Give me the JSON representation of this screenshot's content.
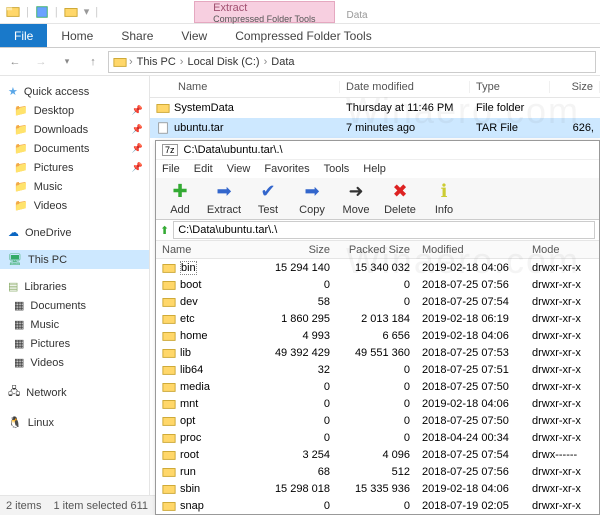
{
  "titlebar": {
    "context_tab": "Extract",
    "context_sub": "Compressed Folder Tools",
    "context_name": "Data"
  },
  "ribbon": {
    "file": "File",
    "tabs": [
      "Home",
      "Share",
      "View"
    ]
  },
  "breadcrumb": [
    "This PC",
    "Local Disk (C:)",
    "Data"
  ],
  "columns": {
    "name": "Name",
    "date": "Date modified",
    "type": "Type",
    "size": "Size"
  },
  "rows": [
    {
      "name": "SystemData",
      "date": "Thursday at 11:46 PM",
      "type": "File folder",
      "size": "",
      "icon": "folder"
    },
    {
      "name": "ubuntu.tar",
      "date": "7 minutes ago",
      "type": "TAR File",
      "size": "626,",
      "icon": "file",
      "selected": true
    }
  ],
  "sidebar": {
    "quick_access": "Quick access",
    "qa": [
      {
        "label": "Desktop",
        "pin": true
      },
      {
        "label": "Downloads",
        "pin": true
      },
      {
        "label": "Documents",
        "pin": true
      },
      {
        "label": "Pictures",
        "pin": true
      },
      {
        "label": "Music",
        "pin": false
      },
      {
        "label": "Videos",
        "pin": false
      }
    ],
    "onedrive": "OneDrive",
    "thispc": "This PC",
    "libraries": "Libraries",
    "libs": [
      "Documents",
      "Music",
      "Pictures",
      "Videos"
    ],
    "network": "Network",
    "linux": "Linux"
  },
  "status": {
    "items": "2 items",
    "selected": "1 item selected  611"
  },
  "sevenzip": {
    "title": "C:\\Data\\ubuntu.tar\\.\\",
    "menu": [
      "File",
      "Edit",
      "View",
      "Favorites",
      "Tools",
      "Help"
    ],
    "tools": [
      {
        "label": "Add",
        "icon": "plus",
        "color": "#3a3"
      },
      {
        "label": "Extract",
        "icon": "minus",
        "color": "#36c"
      },
      {
        "label": "Test",
        "icon": "check",
        "color": "#36c"
      },
      {
        "label": "Copy",
        "icon": "arrow-r",
        "color": "#36c"
      },
      {
        "label": "Move",
        "icon": "arrow-r2",
        "color": "#333"
      },
      {
        "label": "Delete",
        "icon": "x",
        "color": "#d22"
      },
      {
        "label": "Info",
        "icon": "info",
        "color": "#cc3"
      }
    ],
    "path": "C:\\Data\\ubuntu.tar\\.\\",
    "cols": {
      "name": "Name",
      "size": "Size",
      "packed": "Packed Size",
      "modified": "Modified",
      "mode": "Mode"
    },
    "rows": [
      {
        "name": "bin",
        "size": "15 294 140",
        "packed": "15 340 032",
        "mod": "2019-02-18 04:06",
        "mode": "drwxr-xr-x",
        "sel": true
      },
      {
        "name": "boot",
        "size": "0",
        "packed": "0",
        "mod": "2018-07-25 07:56",
        "mode": "drwxr-xr-x"
      },
      {
        "name": "dev",
        "size": "58",
        "packed": "0",
        "mod": "2018-07-25 07:54",
        "mode": "drwxr-xr-x"
      },
      {
        "name": "etc",
        "size": "1 860 295",
        "packed": "2 013 184",
        "mod": "2019-02-18 06:19",
        "mode": "drwxr-xr-x"
      },
      {
        "name": "home",
        "size": "4 993",
        "packed": "6 656",
        "mod": "2019-02-18 04:06",
        "mode": "drwxr-xr-x"
      },
      {
        "name": "lib",
        "size": "49 392 429",
        "packed": "49 551 360",
        "mod": "2018-07-25 07:53",
        "mode": "drwxr-xr-x"
      },
      {
        "name": "lib64",
        "size": "32",
        "packed": "0",
        "mod": "2018-07-25 07:51",
        "mode": "drwxr-xr-x"
      },
      {
        "name": "media",
        "size": "0",
        "packed": "0",
        "mod": "2018-07-25 07:50",
        "mode": "drwxr-xr-x"
      },
      {
        "name": "mnt",
        "size": "0",
        "packed": "0",
        "mod": "2019-02-18 04:06",
        "mode": "drwxr-xr-x"
      },
      {
        "name": "opt",
        "size": "0",
        "packed": "0",
        "mod": "2018-07-25 07:50",
        "mode": "drwxr-xr-x"
      },
      {
        "name": "proc",
        "size": "0",
        "packed": "0",
        "mod": "2018-04-24 00:34",
        "mode": "drwxr-xr-x"
      },
      {
        "name": "root",
        "size": "3 254",
        "packed": "4 096",
        "mod": "2018-07-25 07:54",
        "mode": "drwx------"
      },
      {
        "name": "run",
        "size": "68",
        "packed": "512",
        "mod": "2018-07-25 07:56",
        "mode": "drwxr-xr-x"
      },
      {
        "name": "sbin",
        "size": "15 298 018",
        "packed": "15 335 936",
        "mod": "2019-02-18 04:06",
        "mode": "drwxr-xr-x"
      },
      {
        "name": "snap",
        "size": "0",
        "packed": "0",
        "mod": "2018-07-19 02:05",
        "mode": "drwxr-xr-x"
      }
    ]
  }
}
